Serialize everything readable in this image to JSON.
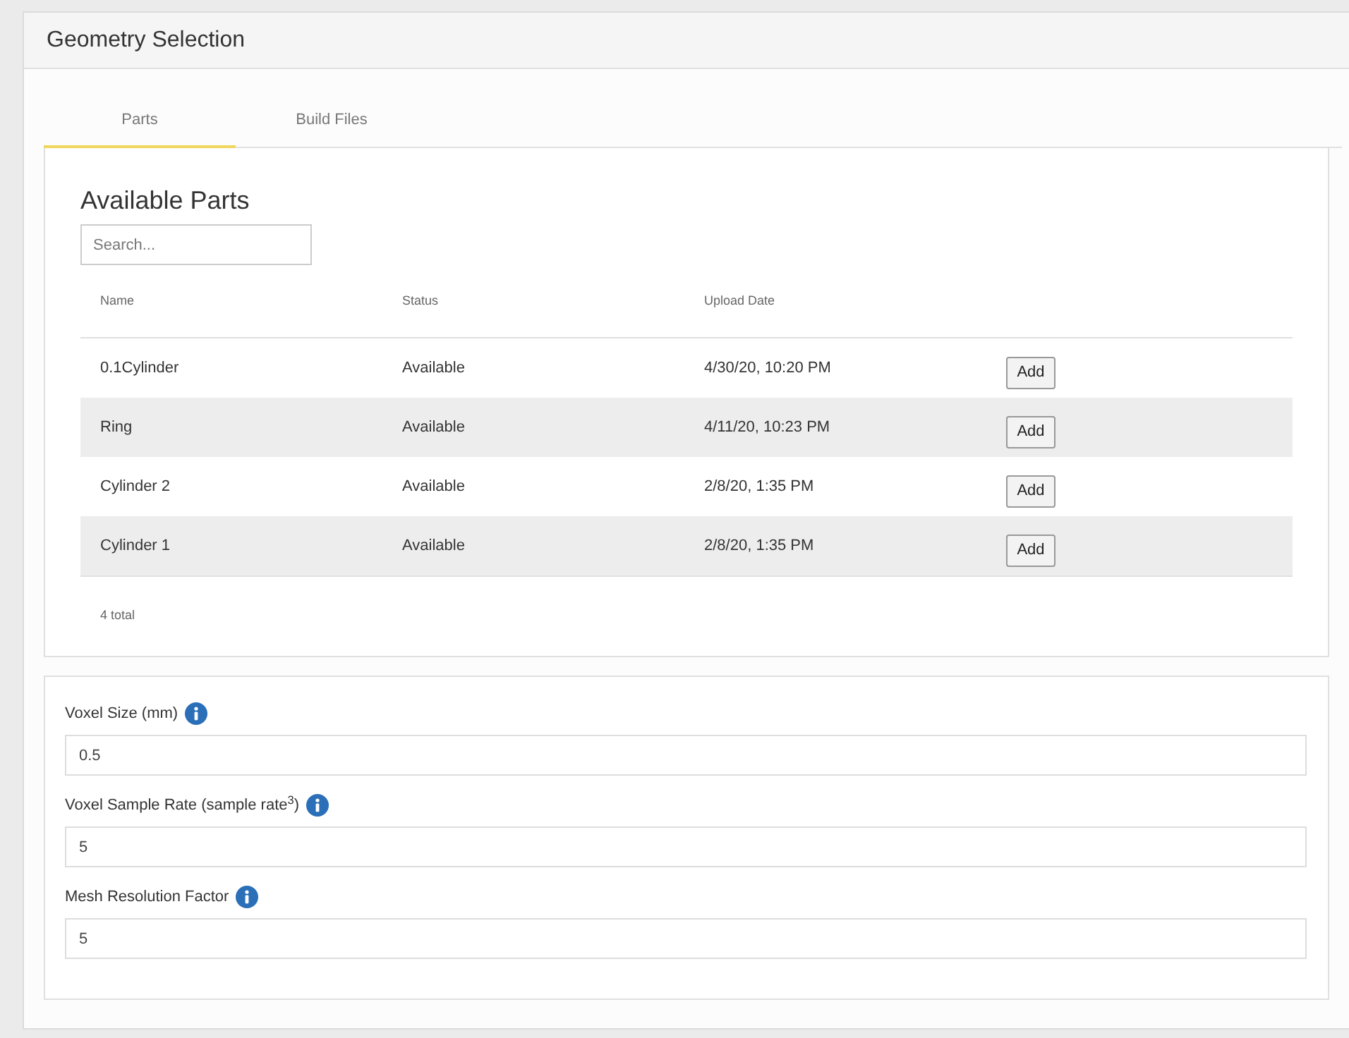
{
  "panel": {
    "title": "Geometry Selection"
  },
  "tabs": [
    {
      "label": "Parts",
      "selected": true
    },
    {
      "label": "Build Files",
      "selected": false
    }
  ],
  "parts": {
    "heading": "Available Parts",
    "search": {
      "placeholder": "Search..."
    },
    "columns": [
      "Name",
      "Status",
      "Upload Date"
    ],
    "rows": [
      {
        "name": "0.1Cylinder",
        "status": "Available",
        "upload_date": "4/30/20, 10:20 PM",
        "action": "Add"
      },
      {
        "name": "Ring",
        "status": "Available",
        "upload_date": "4/11/20, 10:23 PM",
        "action": "Add"
      },
      {
        "name": "Cylinder 2",
        "status": "Available",
        "upload_date": "2/8/20, 1:35 PM",
        "action": "Add"
      },
      {
        "name": "Cylinder 1",
        "status": "Available",
        "upload_date": "2/8/20, 1:35 PM",
        "action": "Add"
      }
    ],
    "total": "4 total"
  },
  "settings": [
    {
      "label": "Voxel Size (mm)",
      "value": "0.5"
    },
    {
      "label": "Voxel Sample Rate (sample rate$^{3}$)",
      "value": "5"
    },
    {
      "label": "Mesh Resolution Factor",
      "value": "5"
    }
  ]
}
